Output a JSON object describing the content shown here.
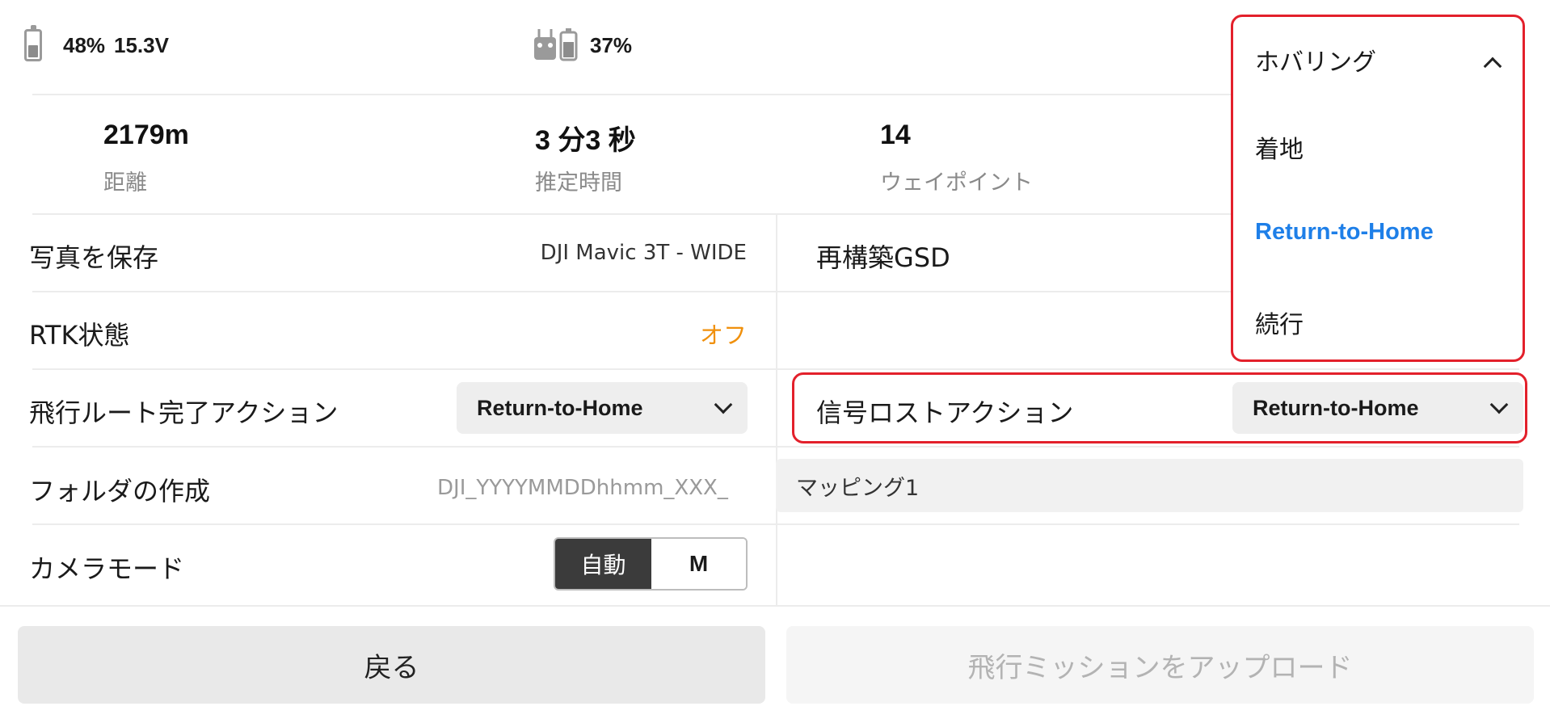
{
  "status_bar": {
    "aircraft_battery_percent": "48%",
    "aircraft_voltage": "15.3V",
    "rc_battery_percent": "37%",
    "aircraft_battery_level": 0.48,
    "icons": [
      "battery-icon",
      "remote-controller-icon"
    ]
  },
  "stats": {
    "distance": {
      "value": "2179m",
      "label": "距離"
    },
    "estimated_time": {
      "value": "3 分3 秒",
      "label": "推定時間"
    },
    "waypoints": {
      "value": "14",
      "label": "ウェイポイント"
    }
  },
  "settings": {
    "save_photo": {
      "label": "写真を保存",
      "value": "DJI Mavic 3T - WIDE"
    },
    "rebuild_gsd": {
      "label": "再構築GSD"
    },
    "rtk_status": {
      "label": "RTK状態",
      "value": "オフ"
    },
    "route_complete_action": {
      "label": "飛行ルート完了アクション",
      "value": "Return-to-Home"
    },
    "signal_lost_action": {
      "label": "信号ロストアクション",
      "value": "Return-to-Home"
    },
    "create_folder": {
      "label": "フォルダの作成",
      "prefix": "DJI_YYYYMMDDhhmm_XXX_",
      "name": "マッピング1"
    },
    "camera_mode": {
      "label": "カメラモード",
      "options": [
        "自動",
        "M"
      ],
      "selected": "自動"
    }
  },
  "dropdown": {
    "current": "ホバリング",
    "options": [
      "着地",
      "Return-to-Home",
      "続行"
    ],
    "selected": "Return-to-Home"
  },
  "footer": {
    "back_label": "戻る",
    "upload_label": "飛行ミッションをアップロード"
  },
  "colors": {
    "accent_blue": "#1e7fe8",
    "warning_orange": "#f0900c",
    "highlight_red": "#e3202b"
  }
}
